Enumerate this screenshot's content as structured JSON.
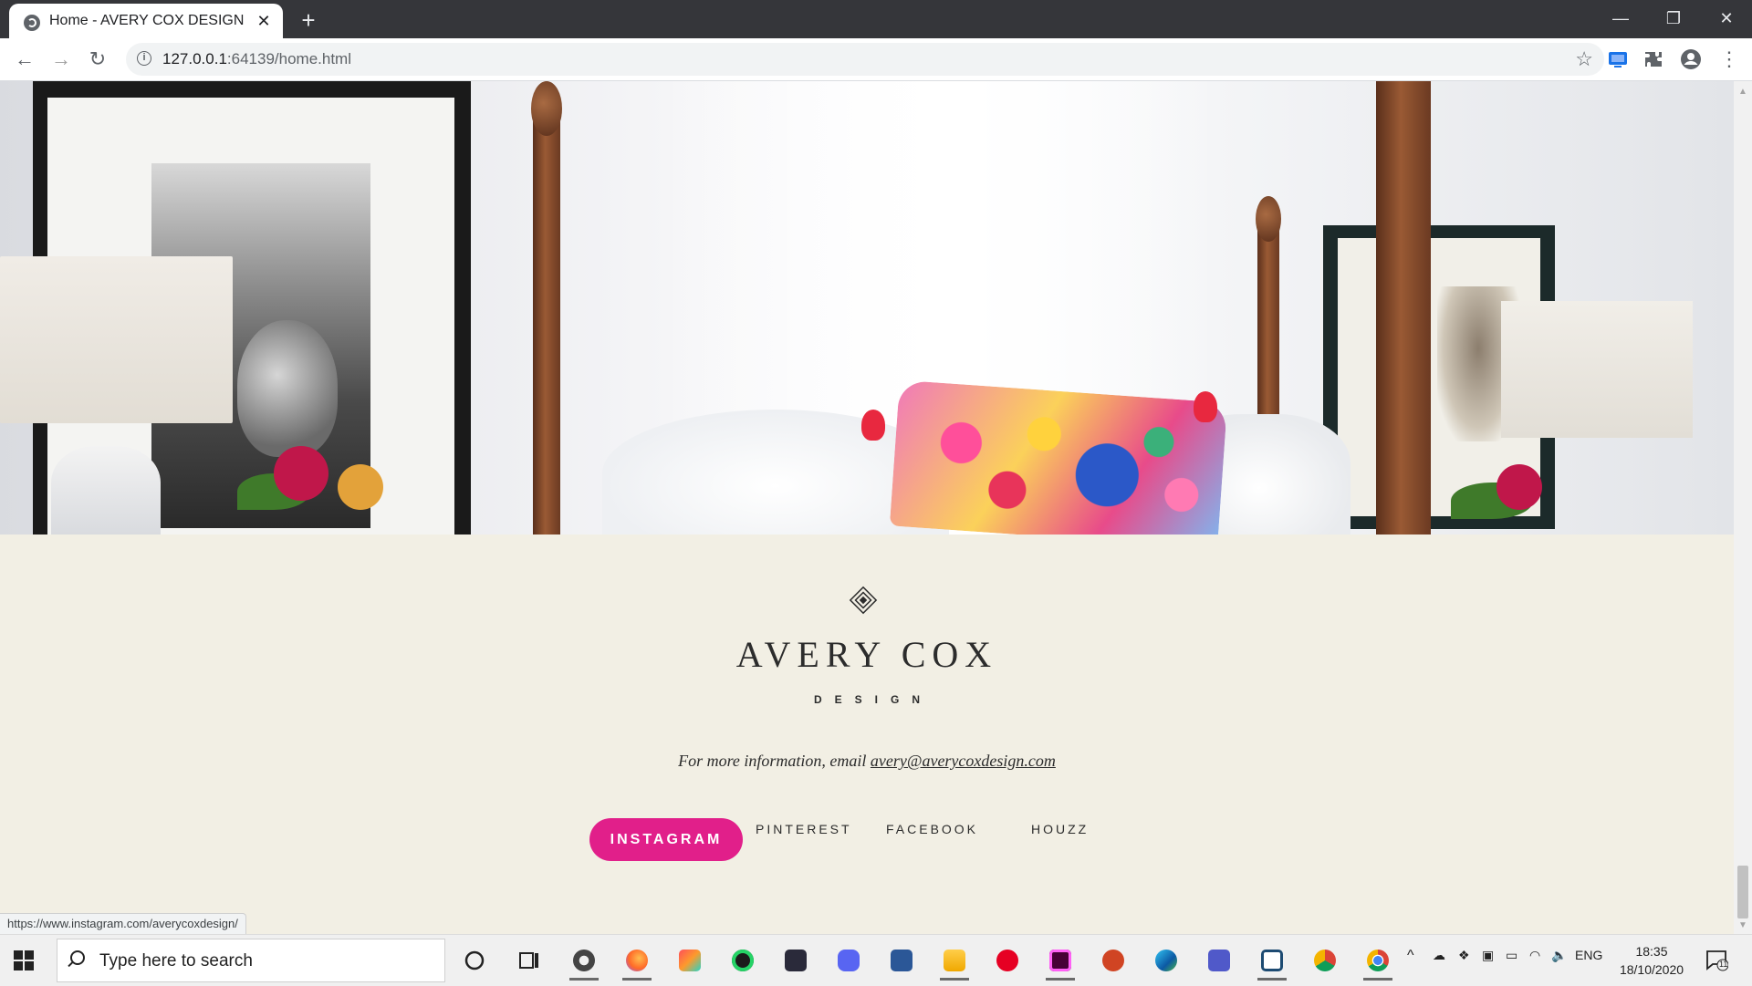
{
  "browser": {
    "tab_title": "Home - AVERY COX DESIGN",
    "url_host": "127.0.0.1",
    "url_rest": ":64139/home.html",
    "status_url": "https://www.instagram.com/averycoxdesign/"
  },
  "footer": {
    "brand_name": "AVERY COX",
    "brand_sub": "DESIGN",
    "info_prefix": "For more information, email",
    "info_email": "avery@averycoxdesign.com",
    "social": {
      "instagram": "INSTAGRAM",
      "pinterest": "PINTEREST",
      "facebook": "FACEBOOK",
      "houzz": "HOUZZ"
    }
  },
  "taskbar": {
    "search_placeholder": "Type here to search",
    "language": "ENG",
    "time": "18:35",
    "date": "18/10/2020",
    "notification_count": "11"
  },
  "colors": {
    "accent": "#e11f8a",
    "footer_bg": "#f2efe4",
    "chrome_dark": "#35363a"
  },
  "icons": [
    "globe-icon",
    "close-icon",
    "plus-icon",
    "minimize-icon",
    "restore-icon",
    "back-icon",
    "forward-icon",
    "reload-icon",
    "info-icon",
    "star-icon",
    "extensions-icon",
    "profile-icon",
    "menu-icon",
    "diamond-logo-icon",
    "windows-start-icon",
    "search-icon",
    "cortana-icon",
    "task-view-icon"
  ]
}
